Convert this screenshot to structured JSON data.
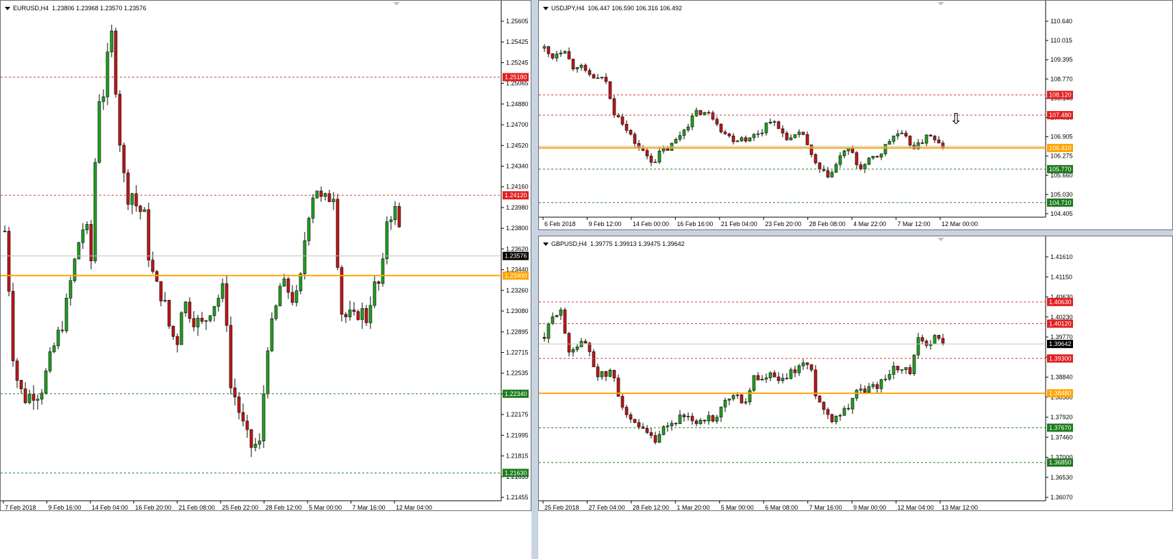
{
  "colors": {
    "bull": "#22a022",
    "bear": "#c01818",
    "orange": "#ffa500",
    "red_line": "#e03030",
    "green_line": "#208020",
    "current_line": "#c0c0c0",
    "current_tag": "#000000"
  },
  "panes": [
    {
      "id": "eurusd",
      "symbol": "EURUSD,H4",
      "ohlc": "1.23806 1.23968 1.23570 1.23576",
      "prices": {
        "min": 1.2138,
        "max": 1.2578
      },
      "price_labels": [
        "1.25605",
        "1.25425",
        "1.25245",
        "1.25065",
        "1.24880",
        "1.24700",
        "1.24520",
        "1.24340",
        "1.24160",
        "1.23980",
        "1.23800",
        "1.23620",
        "1.23440",
        "1.23260",
        "1.23080",
        "1.22895",
        "1.22715",
        "1.22535",
        "1.22355",
        "1.22175",
        "1.21995",
        "1.21815",
        "1.21635",
        "1.21455"
      ],
      "time_labels": [
        "7 Feb 2018",
        "9 Feb 16:00",
        "14 Feb 04:00",
        "16 Feb 20:00",
        "21 Feb 08:00",
        "25 Feb 22:00",
        "28 Feb 12:00",
        "5 Mar 00:00",
        "7 Mar 16:00",
        "12 Mar 04:00"
      ],
      "levels": [
        {
          "price": 1.2518,
          "label": "1.25180",
          "style": "red"
        },
        {
          "price": 1.2412,
          "label": "1.24120",
          "style": "red"
        },
        {
          "price": 1.2234,
          "label": "1.22340",
          "style": "green"
        },
        {
          "price": 1.2163,
          "label": "1.21630",
          "style": "green"
        },
        {
          "price": 1.234,
          "label": "1.23400",
          "style": "orange"
        },
        {
          "price": 1.23576,
          "label": "1.23576",
          "style": "current"
        }
      ],
      "path": [
        [
          0,
          1.238
        ],
        [
          6,
          1.233
        ],
        [
          12,
          1.227
        ],
        [
          20,
          1.224
        ],
        [
          30,
          1.223
        ],
        [
          42,
          1.2235
        ],
        [
          52,
          1.2235
        ],
        [
          64,
          1.226
        ],
        [
          74,
          1.228
        ],
        [
          86,
          1.23
        ],
        [
          98,
          1.234
        ],
        [
          108,
          1.237
        ],
        [
          118,
          1.239
        ],
        [
          126,
          1.235
        ],
        [
          132,
          1.244
        ],
        [
          138,
          1.25
        ],
        [
          146,
          1.2505
        ],
        [
          152,
          1.2545
        ],
        [
          158,
          1.256
        ],
        [
          164,
          1.249
        ],
        [
          170,
          1.245
        ],
        [
          178,
          1.241
        ],
        [
          186,
          1.2415
        ],
        [
          194,
          1.24
        ],
        [
          204,
          1.2395
        ],
        [
          212,
          1.235
        ],
        [
          222,
          1.233
        ],
        [
          232,
          1.232
        ],
        [
          242,
          1.229
        ],
        [
          252,
          1.228
        ],
        [
          260,
          1.232
        ],
        [
          268,
          1.231
        ],
        [
          278,
          1.23
        ],
        [
          290,
          1.2295
        ],
        [
          300,
          1.231
        ],
        [
          312,
          1.232
        ],
        [
          322,
          1.233
        ],
        [
          330,
          1.224
        ],
        [
          338,
          1.223
        ],
        [
          346,
          1.221
        ],
        [
          354,
          1.2195
        ],
        [
          362,
          1.2185
        ],
        [
          370,
          1.219
        ],
        [
          376,
          1.2185
        ],
        [
          380,
          1.226
        ],
        [
          386,
          1.2285
        ],
        [
          394,
          1.23
        ],
        [
          402,
          1.233
        ],
        [
          412,
          1.233
        ],
        [
          420,
          1.232
        ],
        [
          430,
          1.232
        ],
        [
          440,
          1.238
        ],
        [
          448,
          1.241
        ],
        [
          456,
          1.242
        ],
        [
          464,
          1.2405
        ],
        [
          474,
          1.241
        ],
        [
          482,
          1.2415
        ],
        [
          488,
          1.234
        ],
        [
          494,
          1.23
        ],
        [
          502,
          1.2305
        ],
        [
          510,
          1.23
        ],
        [
          520,
          1.231
        ],
        [
          530,
          1.23
        ],
        [
          538,
          1.233
        ],
        [
          546,
          1.233
        ],
        [
          552,
          1.234
        ],
        [
          558,
          1.239
        ],
        [
          564,
          1.2395
        ],
        [
          570,
          1.24
        ],
        [
          576,
          1.239
        ],
        [
          580,
          1.23576
        ]
      ]
    },
    {
      "id": "usdjpy",
      "symbol": "USDJPY,H4",
      "ohlc": "106.447 106.590 106.316 106.492",
      "prices": {
        "min": 104.25,
        "max": 110.8
      },
      "price_labels": [
        "110.640",
        "110.015",
        "109.395",
        "108.770",
        "108.140",
        "107.520",
        "106.905",
        "106.275",
        "105.660",
        "105.030",
        "104.405"
      ],
      "time_labels": [
        "6 Feb 2018",
        "9 Feb 12:00",
        "14 Feb 00:00",
        "16 Feb 16:00",
        "21 Feb 04:00",
        "23 Feb 20:00",
        "28 Feb 08:00",
        "4 Mar 22:00",
        "7 Mar 12:00",
        "12 Mar 00:00"
      ],
      "levels": [
        {
          "price": 108.12,
          "label": "108.120",
          "style": "red"
        },
        {
          "price": 107.48,
          "label": "107.480",
          "style": "red"
        },
        {
          "price": 105.77,
          "label": "105.770",
          "style": "green"
        },
        {
          "price": 104.71,
          "label": "104.710",
          "style": "green"
        },
        {
          "price": 106.44,
          "label": "106.410",
          "style": "orange"
        },
        {
          "price": 106.492,
          "label": "",
          "style": "current"
        }
      ],
      "arrow_label": "⇩",
      "path": [
        [
          0,
          109.6
        ],
        [
          10,
          109.3
        ],
        [
          20,
          109.5
        ],
        [
          30,
          109.6
        ],
        [
          40,
          109.0
        ],
        [
          50,
          109.1
        ],
        [
          60,
          108.8
        ],
        [
          70,
          108.7
        ],
        [
          80,
          108.6
        ],
        [
          90,
          108.6
        ],
        [
          100,
          107.6
        ],
        [
          110,
          107.5
        ],
        [
          120,
          107.0
        ],
        [
          130,
          106.7
        ],
        [
          140,
          106.4
        ],
        [
          150,
          106.2
        ],
        [
          160,
          106.0
        ],
        [
          170,
          106.3
        ],
        [
          180,
          106.4
        ],
        [
          190,
          106.6
        ],
        [
          200,
          106.9
        ],
        [
          210,
          107.2
        ],
        [
          220,
          107.5
        ],
        [
          230,
          107.6
        ],
        [
          240,
          107.5
        ],
        [
          250,
          107.4
        ],
        [
          260,
          107.0
        ],
        [
          270,
          106.8
        ],
        [
          280,
          106.7
        ],
        [
          290,
          106.8
        ],
        [
          300,
          106.7
        ],
        [
          310,
          106.9
        ],
        [
          320,
          107.0
        ],
        [
          330,
          107.4
        ],
        [
          340,
          107.1
        ],
        [
          350,
          106.9
        ],
        [
          360,
          106.7
        ],
        [
          370,
          106.8
        ],
        [
          380,
          106.9
        ],
        [
          390,
          106.2
        ],
        [
          400,
          105.8
        ],
        [
          410,
          105.6
        ],
        [
          420,
          105.6
        ],
        [
          430,
          106.0
        ],
        [
          440,
          106.4
        ],
        [
          450,
          106.3
        ],
        [
          460,
          105.8
        ],
        [
          470,
          105.9
        ],
        [
          480,
          106.1
        ],
        [
          490,
          106.2
        ],
        [
          500,
          106.5
        ],
        [
          510,
          106.8
        ],
        [
          520,
          106.9
        ],
        [
          530,
          106.7
        ],
        [
          540,
          106.5
        ],
        [
          550,
          106.5
        ],
        [
          560,
          106.9
        ],
        [
          570,
          106.7
        ],
        [
          580,
          106.5
        ],
        [
          588,
          106.49
        ]
      ]
    },
    {
      "id": "gbpusd",
      "symbol": "GBPUSD,H4",
      "ohlc": "1.39775 1.39913 1.39475 1.39642",
      "prices": {
        "min": 1.3595,
        "max": 1.4195
      },
      "price_labels": [
        "1.41610",
        "1.41150",
        "1.40630",
        "1.40230",
        "1.39770",
        "1.39300",
        "1.38840",
        "1.38380",
        "1.37920",
        "1.37460",
        "1.37000",
        "1.36530",
        "1.36070"
      ],
      "time_labels": [
        "25 Feb 2018",
        "27 Feb 04:00",
        "28 Feb 12:00",
        "1 Mar 20:00",
        "5 Mar 00:00",
        "6 Mar 08:00",
        "7 Mar 16:00",
        "9 Mar 00:00",
        "12 Mar 04:00",
        "13 Mar 12:00"
      ],
      "levels": [
        {
          "price": 1.4063,
          "label": "1.40630",
          "style": "red"
        },
        {
          "price": 1.4012,
          "label": "1.40120",
          "style": "red"
        },
        {
          "price": 1.393,
          "label": "1.39300",
          "style": "red"
        },
        {
          "price": 1.3767,
          "label": "1.37670",
          "style": "green"
        },
        {
          "price": 1.3685,
          "label": "1.36850",
          "style": "green"
        },
        {
          "price": 1.3848,
          "label": "1.38480",
          "style": "orange"
        },
        {
          "price": 1.39642,
          "label": "1.39642",
          "style": "current"
        }
      ],
      "path": [
        [
          0,
          1.398
        ],
        [
          8,
          1.401
        ],
        [
          16,
          1.404
        ],
        [
          24,
          1.405
        ],
        [
          32,
          1.394
        ],
        [
          40,
          1.396
        ],
        [
          48,
          1.396
        ],
        [
          56,
          1.397
        ],
        [
          64,
          1.395
        ],
        [
          72,
          1.39
        ],
        [
          80,
          1.389
        ],
        [
          88,
          1.389
        ],
        [
          96,
          1.39
        ],
        [
          104,
          1.385
        ],
        [
          112,
          1.382
        ],
        [
          120,
          1.378
        ],
        [
          128,
          1.377
        ],
        [
          136,
          1.376
        ],
        [
          144,
          1.375
        ],
        [
          152,
          1.374
        ],
        [
          160,
          1.373
        ],
        [
          168,
          1.376
        ],
        [
          176,
          1.377
        ],
        [
          184,
          1.378
        ],
        [
          192,
          1.379
        ],
        [
          200,
          1.378
        ],
        [
          208,
          1.379
        ],
        [
          216,
          1.378
        ],
        [
          224,
          1.379
        ],
        [
          232,
          1.379
        ],
        [
          240,
          1.377
        ],
        [
          248,
          1.38
        ],
        [
          256,
          1.383
        ],
        [
          264,
          1.384
        ],
        [
          272,
          1.384
        ],
        [
          280,
          1.383
        ],
        [
          288,
          1.383
        ],
        [
          296,
          1.389
        ],
        [
          304,
          1.388
        ],
        [
          312,
          1.388
        ],
        [
          320,
          1.389
        ],
        [
          328,
          1.388
        ],
        [
          336,
          1.387
        ],
        [
          344,
          1.389
        ],
        [
          352,
          1.39
        ],
        [
          360,
          1.391
        ],
        [
          368,
          1.392
        ],
        [
          376,
          1.391
        ],
        [
          384,
          1.385
        ],
        [
          392,
          1.382
        ],
        [
          400,
          1.38
        ],
        [
          408,
          1.379
        ],
        [
          416,
          1.38
        ],
        [
          424,
          1.381
        ],
        [
          432,
          1.382
        ],
        [
          440,
          1.386
        ],
        [
          448,
          1.385
        ],
        [
          456,
          1.386
        ],
        [
          464,
          1.386
        ],
        [
          472,
          1.387
        ],
        [
          480,
          1.388
        ],
        [
          488,
          1.39
        ],
        [
          496,
          1.391
        ],
        [
          504,
          1.39
        ],
        [
          512,
          1.39
        ],
        [
          520,
          1.389
        ],
        [
          528,
          1.398
        ],
        [
          536,
          1.396
        ],
        [
          544,
          1.397
        ],
        [
          552,
          1.398
        ],
        [
          560,
          1.397
        ],
        [
          568,
          1.3964
        ]
      ]
    }
  ]
}
